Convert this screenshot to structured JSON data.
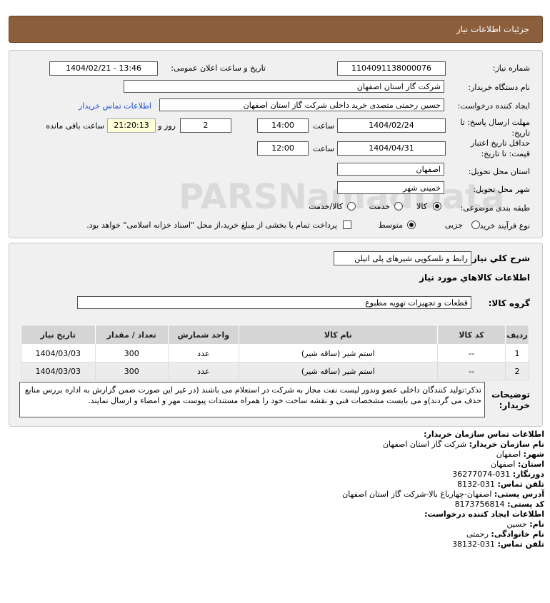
{
  "header": {
    "title": "جزئیات اطلاعات نیاز"
  },
  "form": {
    "need_number_label": "شماره نیاز:",
    "need_number": "1104091138000076",
    "announce_label": "تاریخ و ساعت اعلان عمومی:",
    "announce_value": "1404/02/21 - 13:46",
    "buyer_org_label": "نام دستگاه خریدار:",
    "buyer_org": "شرکت گاز استان اصفهان",
    "creator_label": "ایجاد کننده درخواست:",
    "creator": "حسین  رحمتی متصدی خرید داخلی شرکت گاز استان اصفهان",
    "contact_link": "اطلاعات تماس خریدار",
    "deadline_label": "مهلت ارسال پاسخ: تا تاریخ:",
    "deadline_date": "1404/02/24",
    "time_label": "ساعت",
    "deadline_time": "14:00",
    "days_value": "2",
    "days_label": "روز و",
    "remaining_time": "21:20:13",
    "remaining_label": "ساعت باقی مانده",
    "validity_label": "حداقل تاریخ اعتبار قیمت: تا تاریخ:",
    "validity_date": "1404/04/31",
    "validity_time": "12:00",
    "province_label": "استان محل تحویل:",
    "province": "اصفهان",
    "city_label": "شهر محل تحویل:",
    "city": "خمینی شهر",
    "category_label": "طبقه بندی موضوعی:",
    "category_options": [
      "کالا",
      "خدمت",
      "کالا/خدمت"
    ],
    "process_label": "نوع فرآیند خرید :",
    "process_options": [
      "جزیی",
      "متوسط"
    ],
    "payment_note": "پرداخت تمام یا بخشی از مبلغ خرید،از محل \"اسناد خزانه اسلامی\" خواهد بود."
  },
  "needs": {
    "summary_label": "شرح كلي نياز:",
    "summary": "رابط و تلسکوپی شیرهای پلی اتیلن",
    "goods_info_title": "اطلاعات كالاهاي مورد نياز",
    "group_label": "گروه کالا:",
    "group_value": "قطعات و تجهیزات تهویه مطبوع",
    "columns": [
      "ردیف",
      "کد کالا",
      "نام کالا",
      "واحد شمارش",
      "تعداد / مقدار",
      "تاریخ نیاز"
    ],
    "rows": [
      {
        "row": "1",
        "code": "--",
        "name": "استم شیر (ساقه شیر)",
        "unit": "عدد",
        "qty": "300",
        "date": "1404/03/03"
      },
      {
        "row": "2",
        "code": "--",
        "name": "استم شیر (ساقه شیر)",
        "unit": "عدد",
        "qty": "300",
        "date": "1404/03/03"
      }
    ],
    "notes_label": "توضیحات خریدار:",
    "notes": "تذکر:تولید کنندگان داخلی عضو وندور لیست نفت مجاز به شرکت در استعلام می باشند (در غیر این صورت ضمن گزارش به اداره بررس منابع حذف می گردند)و می بایست مشخصات فنی و نقشه ساخت خود را همراه مستندات پیوست مهر و امضاء و ارسال نمایند."
  },
  "contact": {
    "org_title": "اطلاعات تماس سازمان خریدار:",
    "org_name_label": "نام سازمان خریدار:",
    "org_name": "شرکت گاز استان اصفهان",
    "city_label": "شهر:",
    "city": "اصفهان",
    "province_label": "استان:",
    "province": "اصفهان",
    "fax_label": "دورنگار:",
    "fax": "031-36277074",
    "phone_label": "تلفن تماس:",
    "phone": "031-8132",
    "address_label": "آدرس پستی:",
    "address": "اصفهان-چهارباغ بالا-شرکت گاز استان اصفهان",
    "postal_label": "کد پستی:",
    "postal": "8173756814",
    "creator_title": "اطلاعات ایجاد کننده درخواست:",
    "first_name_label": "نام:",
    "first_name": "حسین",
    "last_name_label": "نام خانوادگی:",
    "last_name": "رحمتی",
    "creator_phone_label": "تلفن تماس:",
    "creator_phone": "031-38132"
  },
  "colors": {
    "header_bg": "#8b5e3c",
    "panel_bg": "#f0f0f0",
    "link": "#1a4fd6"
  }
}
